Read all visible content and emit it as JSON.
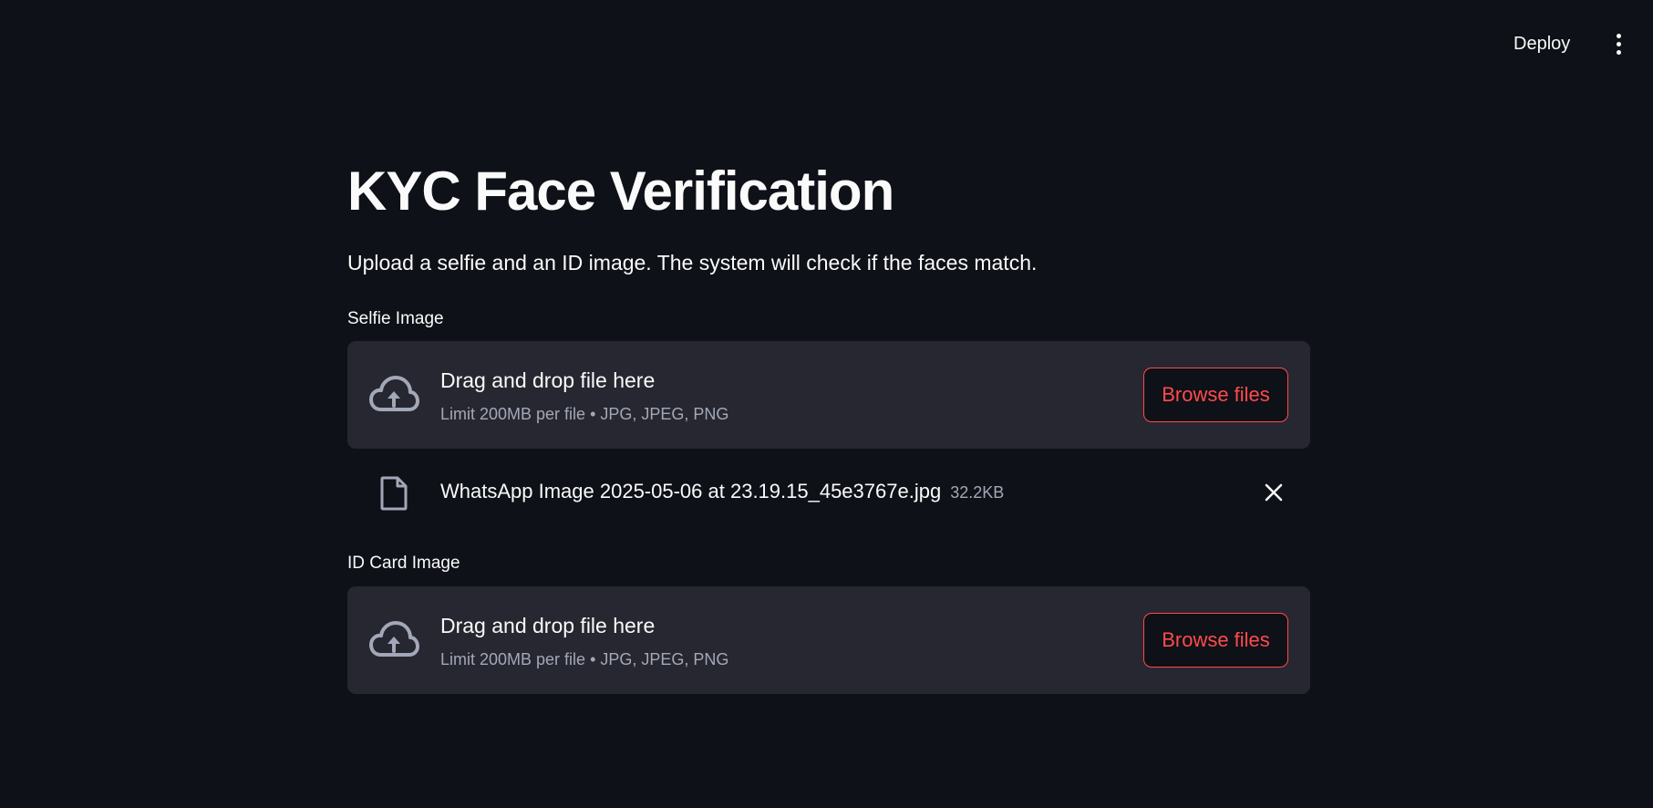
{
  "header": {
    "deploy_label": "Deploy",
    "menu_icon": "more-vertical-icon"
  },
  "main": {
    "title": "KYC Face Verification",
    "subtitle": "Upload a selfie and an ID image. The system will check if the faces match."
  },
  "uploaders": [
    {
      "label": "Selfie Image",
      "drop_text": "Drag and drop file here",
      "limit_text": "Limit 200MB per file • JPG, JPEG, PNG",
      "button_label": "Browse files",
      "icon": "cloud-upload-icon"
    },
    {
      "label": "ID Card Image",
      "drop_text": "Drag and drop file here",
      "limit_text": "Limit 200MB per file • JPG, JPEG, PNG",
      "button_label": "Browse files",
      "icon": "cloud-upload-icon"
    }
  ],
  "uploaded_file": {
    "name": "WhatsApp Image 2025-05-06 at 23.19.15_45e3767e.jpg",
    "size": "32.2KB",
    "icon": "file-icon"
  },
  "colors": {
    "background": "#0e1117",
    "dropzone": "#262730",
    "accent": "#ff4b4b",
    "muted_text": "#a3a8b8",
    "text": "#fafafa"
  }
}
